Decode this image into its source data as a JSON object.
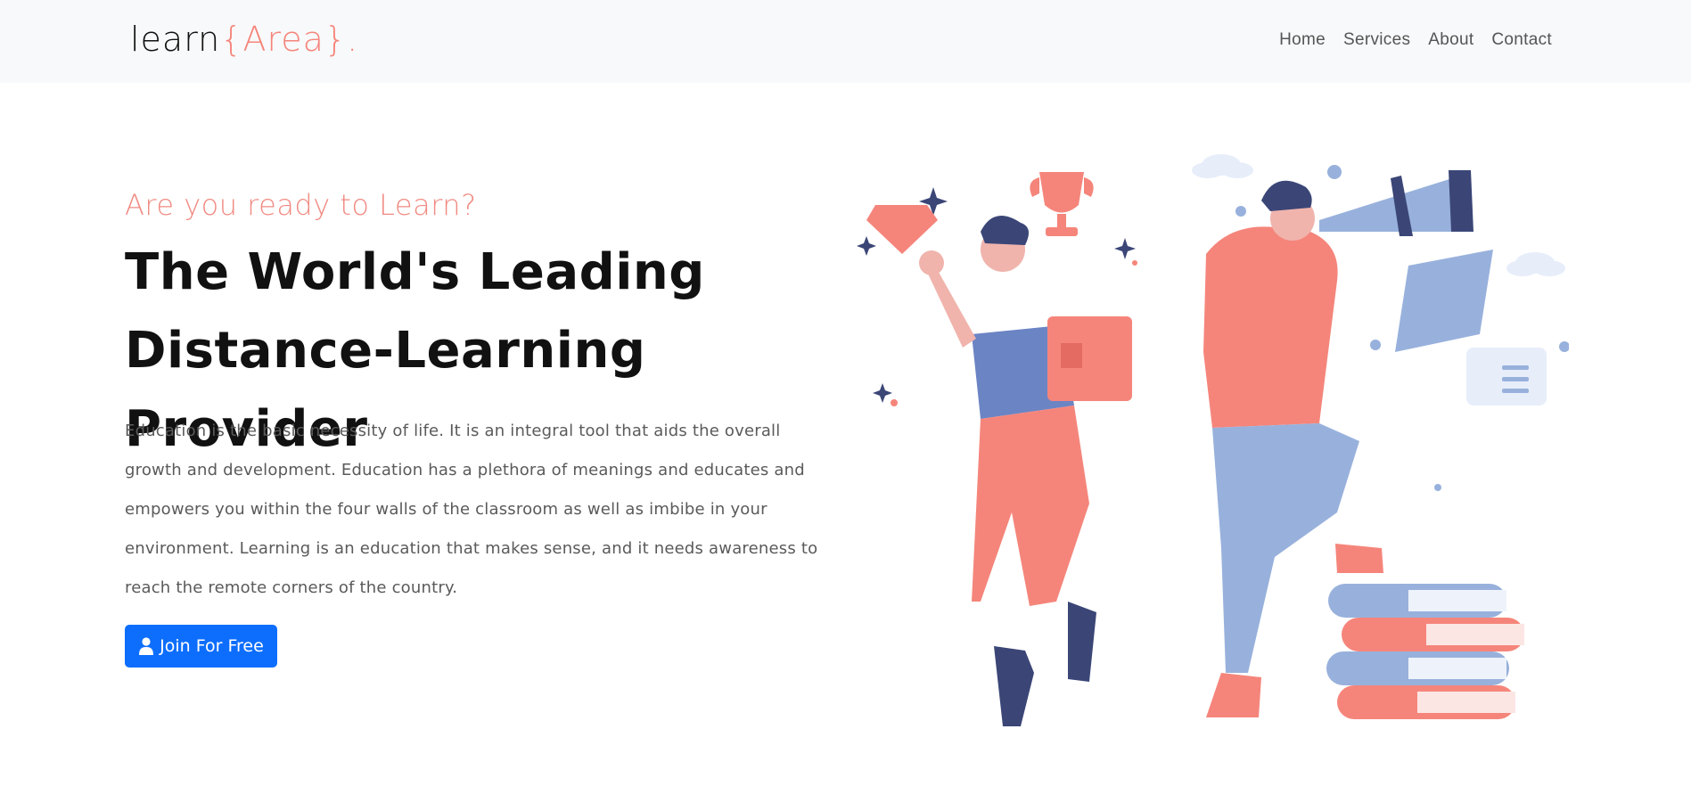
{
  "navbar": {
    "brand_main": "learn",
    "brand_accent": "{Area}.",
    "links": [
      {
        "label": "Home"
      },
      {
        "label": "Services"
      },
      {
        "label": "About"
      },
      {
        "label": "Contact"
      }
    ]
  },
  "hero": {
    "subtitle": "Are you ready to Learn?",
    "headline": "The World's Leading Distance-Learning Provider",
    "paragraph": "Education is the basic necessity of life. It is an integral tool that aids the overall growth and development. Education has a plethora of meanings and educates and empowers you within the four walls of the classroom as well as imbibe in your environment. Learning is an education that makes sense, and it needs awareness to reach the remote corners of the country.",
    "button_label": "Join For Free",
    "button_icon": "user-icon"
  },
  "colors": {
    "accent": "#f5857b",
    "primary_button": "#0d6efd",
    "navbar_bg": "#f8f9fa",
    "illustration_blue": "#6b84c4",
    "illustration_light_blue": "#98b1dc",
    "illustration_navy": "#3b4677"
  }
}
